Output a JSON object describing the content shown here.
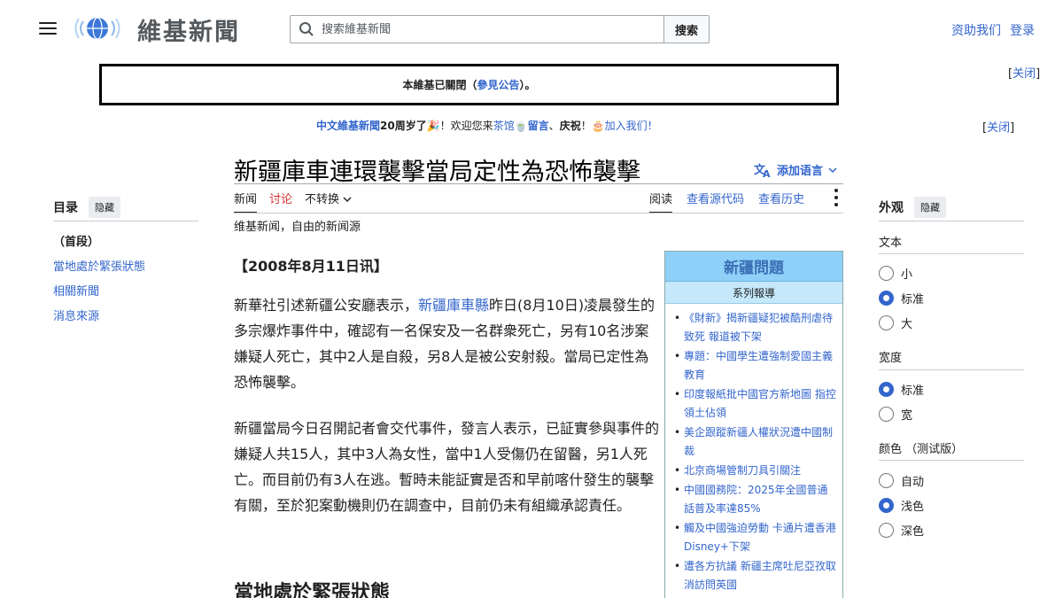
{
  "header": {
    "logo_text": "維基新聞",
    "search_placeholder": "搜索維基新聞",
    "search_button": "搜索",
    "donate": "资助我们",
    "login": "登录"
  },
  "notice": {
    "before": "本維基已關閉（",
    "link": "參見公告",
    "after": "）。",
    "close_before": "[",
    "close_label": "关闭",
    "close_after": "]"
  },
  "anniversary": {
    "name": "中文維基新聞",
    "years": "20周岁了",
    "excl": "！欢迎您来",
    "teahouse": "茶馆",
    "comma1": "、",
    "comment": "留言",
    "comma2": "、",
    "celebrate": "庆祝",
    "excl2": "！",
    "join": "加入我们！",
    "close_label": "关闭"
  },
  "page": {
    "title": "新疆庫車連環襲擊當局定性為恐怖襲擊",
    "add_languages": "添加语言",
    "tabs_left": [
      "新闻",
      "讨论",
      "不转换"
    ],
    "tabs_right": [
      "阅读",
      "查看源代码",
      "查看历史"
    ],
    "tagline": "维基新闻，自由的新闻源"
  },
  "article": {
    "dateline": "【2008年8月11日讯】",
    "p1_before": "新華社引述新疆公安廳表示，",
    "p1_link": "新疆庫車縣",
    "p1_after": "昨日(8月10日)凌晨發生的多宗爆炸事件中，確認有一名保安及一名群衆死亡，另有10名涉案嫌疑人死亡，其中2人是自殺，另8人是被公安射殺。當局已定性為恐怖襲擊。",
    "p2": "新疆當局今日召開記者會交代事件，發言人表示，已証實參與事件的嫌疑人共15人，其中3人為女性，當中1人受傷仍在留醫，另1人死亡。而目前仍有3人在逃。暫時未能証實是否和早前喀什發生的襲擊有關，至於犯案動機則仍在調查中，目前仍未有組織承認責任。",
    "h2": "當地處於緊張狀態"
  },
  "infobox": {
    "title": "新疆問題",
    "subtitle": "系列報導",
    "items": [
      "《財新》揭新疆疑犯被酷刑虐待致死 報道被下架",
      "專題：中國學生遭強制愛國主義教育",
      "印度報紙批中國官方新地圖 指控領土佔領",
      "美企跟蹤新疆人權狀況遭中國制裁",
      "北京商場管制刀具引關注",
      "中國國務院：2025年全國普通話普及率達85%",
      "觸及中國強迫勞動 卡通片遭香港Disney+下架",
      "遭各方抗議 新疆主席吐尼亞孜取消訪問英國"
    ]
  },
  "toc": {
    "title": "目录",
    "hide": "隐藏",
    "items": [
      "（首段）",
      "當地處於緊張狀態",
      "相關新聞",
      "消息來源"
    ]
  },
  "appearance": {
    "title": "外观",
    "hide": "隐藏",
    "text_label": "文本",
    "text_options": [
      "小",
      "标准",
      "大"
    ],
    "text_selected": "标准",
    "width_label": "宽度",
    "width_options": [
      "标准",
      "宽"
    ],
    "width_selected": "标准",
    "color_label": "颜色 （测试版）",
    "color_options": [
      "自动",
      "浅色",
      "深色"
    ],
    "color_selected": "浅色"
  },
  "colors": {
    "link": "#3366cc",
    "talk_tab": "#d73333",
    "infobox_header": "#8fd0f8"
  }
}
